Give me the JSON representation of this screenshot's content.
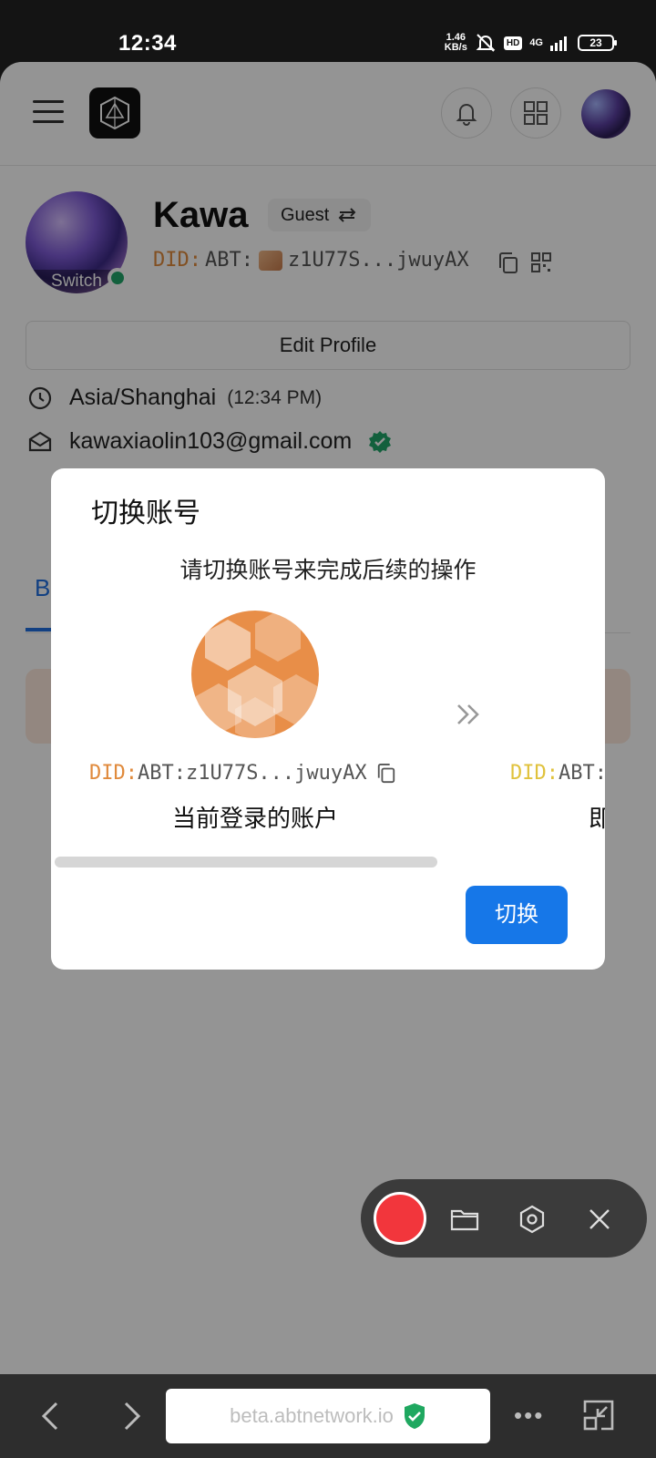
{
  "status_bar": {
    "time": "12:34",
    "net_speed_value": "1.46",
    "net_speed_unit": "KB/s",
    "hd": "HD",
    "network": "4G",
    "battery": "23"
  },
  "profile": {
    "name": "Kawa",
    "switch_label": "Switch",
    "role": "Guest",
    "did_prefix": "DID:",
    "did_scheme": "ABT:",
    "did_value": "z1U77S...jwuyAX",
    "edit_label": "Edit Profile",
    "timezone": "Asia/Shanghai",
    "timezone_time": "(12:34 PM)",
    "email": "kawaxiaolin103@gmail.com",
    "tab_partial": "B"
  },
  "modal": {
    "title": "切换账号",
    "description": "请切换账号来完成后续的操作",
    "current_did_prefix": "DID:",
    "current_did_value": "ABT:z1U77S...jwuyAX",
    "current_label": "当前登录的账户",
    "target_did_prefix": "DID:",
    "target_did_value": "ABT:",
    "target_label": "即",
    "switch_button": "切换"
  },
  "browser": {
    "url": "beta.abtnetwork.io"
  },
  "colors": {
    "primary": "#1677e8",
    "did_orange": "#e08a3c",
    "online_green": "#21a56a",
    "record_red": "#f2363c"
  }
}
